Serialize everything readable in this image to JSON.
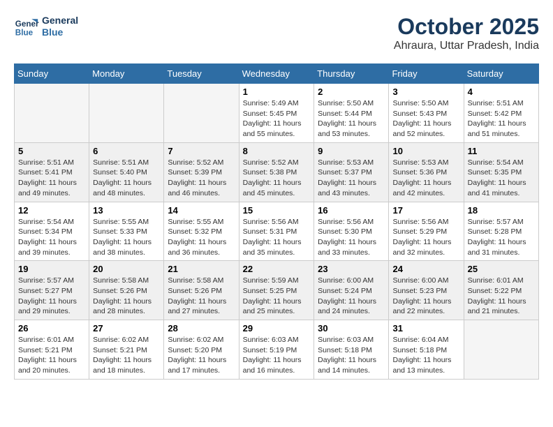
{
  "header": {
    "logo_line1": "General",
    "logo_line2": "Blue",
    "month": "October 2025",
    "location": "Ahraura, Uttar Pradesh, India"
  },
  "weekdays": [
    "Sunday",
    "Monday",
    "Tuesday",
    "Wednesday",
    "Thursday",
    "Friday",
    "Saturday"
  ],
  "weeks": [
    [
      {
        "day": "",
        "info": ""
      },
      {
        "day": "",
        "info": ""
      },
      {
        "day": "",
        "info": ""
      },
      {
        "day": "1",
        "info": "Sunrise: 5:49 AM\nSunset: 5:45 PM\nDaylight: 11 hours\nand 55 minutes."
      },
      {
        "day": "2",
        "info": "Sunrise: 5:50 AM\nSunset: 5:44 PM\nDaylight: 11 hours\nand 53 minutes."
      },
      {
        "day": "3",
        "info": "Sunrise: 5:50 AM\nSunset: 5:43 PM\nDaylight: 11 hours\nand 52 minutes."
      },
      {
        "day": "4",
        "info": "Sunrise: 5:51 AM\nSunset: 5:42 PM\nDaylight: 11 hours\nand 51 minutes."
      }
    ],
    [
      {
        "day": "5",
        "info": "Sunrise: 5:51 AM\nSunset: 5:41 PM\nDaylight: 11 hours\nand 49 minutes."
      },
      {
        "day": "6",
        "info": "Sunrise: 5:51 AM\nSunset: 5:40 PM\nDaylight: 11 hours\nand 48 minutes."
      },
      {
        "day": "7",
        "info": "Sunrise: 5:52 AM\nSunset: 5:39 PM\nDaylight: 11 hours\nand 46 minutes."
      },
      {
        "day": "8",
        "info": "Sunrise: 5:52 AM\nSunset: 5:38 PM\nDaylight: 11 hours\nand 45 minutes."
      },
      {
        "day": "9",
        "info": "Sunrise: 5:53 AM\nSunset: 5:37 PM\nDaylight: 11 hours\nand 43 minutes."
      },
      {
        "day": "10",
        "info": "Sunrise: 5:53 AM\nSunset: 5:36 PM\nDaylight: 11 hours\nand 42 minutes."
      },
      {
        "day": "11",
        "info": "Sunrise: 5:54 AM\nSunset: 5:35 PM\nDaylight: 11 hours\nand 41 minutes."
      }
    ],
    [
      {
        "day": "12",
        "info": "Sunrise: 5:54 AM\nSunset: 5:34 PM\nDaylight: 11 hours\nand 39 minutes."
      },
      {
        "day": "13",
        "info": "Sunrise: 5:55 AM\nSunset: 5:33 PM\nDaylight: 11 hours\nand 38 minutes."
      },
      {
        "day": "14",
        "info": "Sunrise: 5:55 AM\nSunset: 5:32 PM\nDaylight: 11 hours\nand 36 minutes."
      },
      {
        "day": "15",
        "info": "Sunrise: 5:56 AM\nSunset: 5:31 PM\nDaylight: 11 hours\nand 35 minutes."
      },
      {
        "day": "16",
        "info": "Sunrise: 5:56 AM\nSunset: 5:30 PM\nDaylight: 11 hours\nand 33 minutes."
      },
      {
        "day": "17",
        "info": "Sunrise: 5:56 AM\nSunset: 5:29 PM\nDaylight: 11 hours\nand 32 minutes."
      },
      {
        "day": "18",
        "info": "Sunrise: 5:57 AM\nSunset: 5:28 PM\nDaylight: 11 hours\nand 31 minutes."
      }
    ],
    [
      {
        "day": "19",
        "info": "Sunrise: 5:57 AM\nSunset: 5:27 PM\nDaylight: 11 hours\nand 29 minutes."
      },
      {
        "day": "20",
        "info": "Sunrise: 5:58 AM\nSunset: 5:26 PM\nDaylight: 11 hours\nand 28 minutes."
      },
      {
        "day": "21",
        "info": "Sunrise: 5:58 AM\nSunset: 5:26 PM\nDaylight: 11 hours\nand 27 minutes."
      },
      {
        "day": "22",
        "info": "Sunrise: 5:59 AM\nSunset: 5:25 PM\nDaylight: 11 hours\nand 25 minutes."
      },
      {
        "day": "23",
        "info": "Sunrise: 6:00 AM\nSunset: 5:24 PM\nDaylight: 11 hours\nand 24 minutes."
      },
      {
        "day": "24",
        "info": "Sunrise: 6:00 AM\nSunset: 5:23 PM\nDaylight: 11 hours\nand 22 minutes."
      },
      {
        "day": "25",
        "info": "Sunrise: 6:01 AM\nSunset: 5:22 PM\nDaylight: 11 hours\nand 21 minutes."
      }
    ],
    [
      {
        "day": "26",
        "info": "Sunrise: 6:01 AM\nSunset: 5:21 PM\nDaylight: 11 hours\nand 20 minutes."
      },
      {
        "day": "27",
        "info": "Sunrise: 6:02 AM\nSunset: 5:21 PM\nDaylight: 11 hours\nand 18 minutes."
      },
      {
        "day": "28",
        "info": "Sunrise: 6:02 AM\nSunset: 5:20 PM\nDaylight: 11 hours\nand 17 minutes."
      },
      {
        "day": "29",
        "info": "Sunrise: 6:03 AM\nSunset: 5:19 PM\nDaylight: 11 hours\nand 16 minutes."
      },
      {
        "day": "30",
        "info": "Sunrise: 6:03 AM\nSunset: 5:18 PM\nDaylight: 11 hours\nand 14 minutes."
      },
      {
        "day": "31",
        "info": "Sunrise: 6:04 AM\nSunset: 5:18 PM\nDaylight: 11 hours\nand 13 minutes."
      },
      {
        "day": "",
        "info": ""
      }
    ]
  ]
}
